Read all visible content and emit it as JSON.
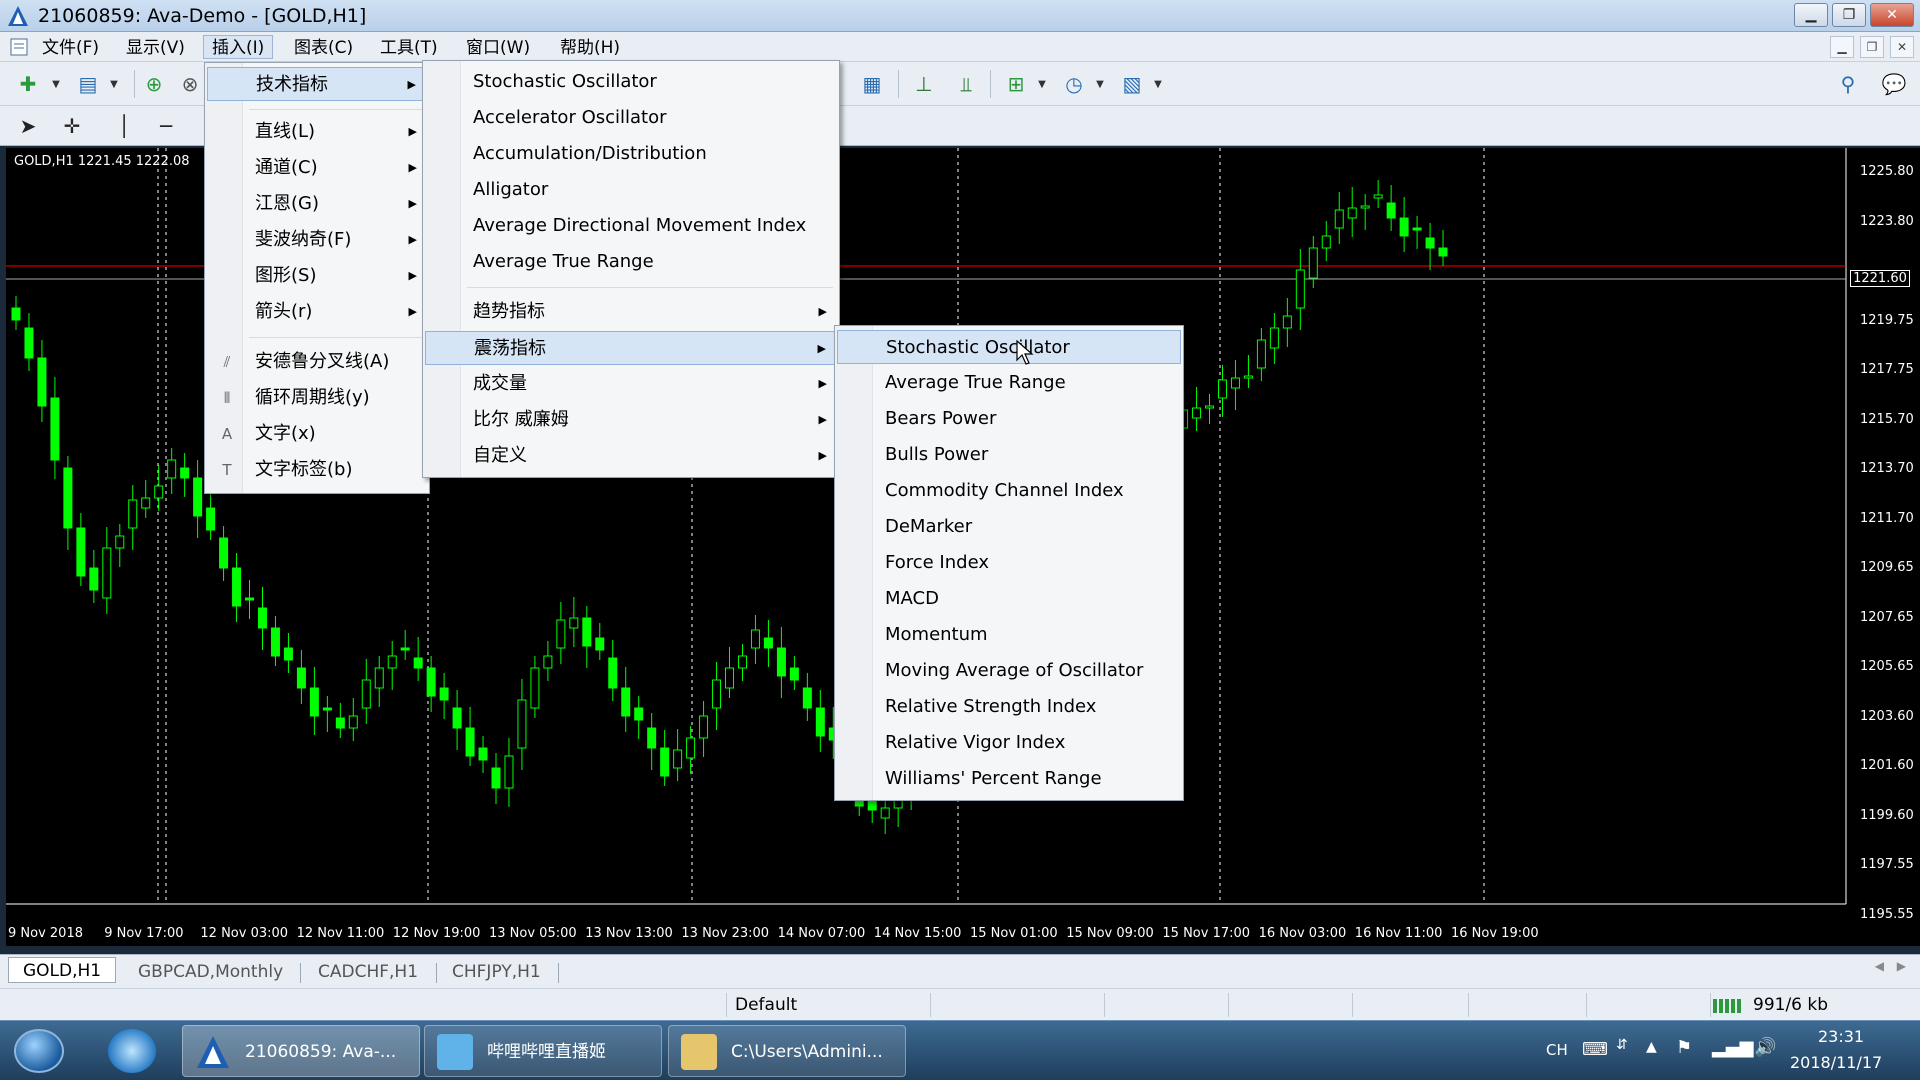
{
  "window": {
    "title": "21060859: Ava-Demo - [GOLD,H1]"
  },
  "menubar": {
    "items": [
      "文件(F)",
      "显示(V)",
      "插入(I)",
      "图表(C)",
      "工具(T)",
      "窗口(W)",
      "帮助(H)"
    ],
    "active": "插入(I)"
  },
  "insert_menu": {
    "items": [
      {
        "label": "技术指标",
        "submenu": true,
        "highlighted": true
      },
      {
        "label": "直线(L)",
        "submenu": true
      },
      {
        "label": "通道(C)",
        "submenu": true
      },
      {
        "label": "江恩(G)",
        "submenu": true
      },
      {
        "label": "斐波纳奇(F)",
        "submenu": true
      },
      {
        "label": "图形(S)",
        "submenu": true
      },
      {
        "label": "箭头(r)",
        "submenu": true
      },
      {
        "label": "安德鲁分叉线(A)",
        "icon": "andrews-pitchfork-icon"
      },
      {
        "label": "循环周期线(y)",
        "icon": "cycle-lines-icon"
      },
      {
        "label": "文字(x)",
        "icon": "text-icon"
      },
      {
        "label": "文字标签(b)",
        "icon": "text-label-icon"
      }
    ]
  },
  "indicators_menu": {
    "items": [
      "Stochastic Oscillator",
      "Accelerator Oscillator",
      "Accumulation/Distribution",
      "Alligator",
      "Average Directional Movement Index",
      "Average True Range"
    ],
    "groups": [
      {
        "label": "趋势指标"
      },
      {
        "label": "震荡指标",
        "highlighted": true
      },
      {
        "label": "成交量"
      },
      {
        "label": "比尔 威廉姆"
      },
      {
        "label": "自定义"
      }
    ]
  },
  "oscillators_menu": {
    "items": [
      "Stochastic Oscillator",
      "Average True Range",
      "Bears Power",
      "Bulls Power",
      "Commodity Channel Index",
      "DeMarker",
      "Force Index",
      "MACD",
      "Momentum",
      "Moving Average of Oscillator",
      "Relative Strength Index",
      "Relative Vigor Index",
      "Williams' Percent Range"
    ],
    "highlighted": "Stochastic Oscillator"
  },
  "chart": {
    "label": "GOLD,H1  1221.45 1222.08",
    "current_price": "1221.60",
    "price_ticks": [
      "1225.80",
      "1223.80",
      "1221.60",
      "1219.75",
      "1217.75",
      "1215.70",
      "1213.70",
      "1211.70",
      "1209.65",
      "1207.65",
      "1205.65",
      "1203.60",
      "1201.60",
      "1199.60",
      "1197.55",
      "1195.55"
    ],
    "time_ticks": [
      "9 Nov 2018",
      "9 Nov 17:00",
      "12 Nov 03:00",
      "12 Nov 11:00",
      "12 Nov 19:00",
      "13 Nov 05:00",
      "13 Nov 13:00",
      "13 Nov 23:00",
      "14 Nov 07:00",
      "14 Nov 15:00",
      "15 Nov 01:00",
      "15 Nov 09:00",
      "15 Nov 17:00",
      "16 Nov 03:00",
      "16 Nov 11:00",
      "16 Nov 19:00"
    ],
    "colors": {
      "bull": "#00ff00",
      "bear": "#00ff00",
      "background": "#000000",
      "price_line": "#ff0000"
    }
  },
  "tabs": {
    "items": [
      "GOLD,H1",
      "GBPCAD,Monthly",
      "CADCHF,H1",
      "CHFJPY,H1"
    ],
    "active": "GOLD,H1"
  },
  "statusbar": {
    "profile": "Default",
    "traffic": "991/6 kb"
  },
  "taskbar": {
    "apps": [
      "21060859: Ava-...",
      "哔哩哔哩直播姬",
      "C:\\Users\\Admini..."
    ],
    "active": "21060859: Ava-...",
    "lang": "CH",
    "time": "23:31",
    "date": "2018/11/17"
  }
}
